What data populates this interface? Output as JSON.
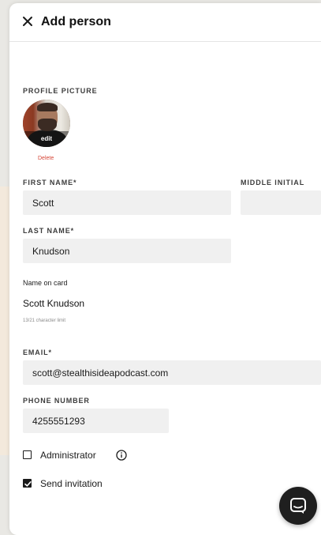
{
  "header": {
    "title": "Add person"
  },
  "profile": {
    "section_label": "PROFILE PICTURE",
    "edit_label": "edit",
    "delete_label": "Delete"
  },
  "form": {
    "first_name": {
      "label": "FIRST NAME",
      "required_mark": "*",
      "value": "Scott"
    },
    "middle_initial": {
      "label": "MIDDLE INITIAL",
      "value": ""
    },
    "last_name": {
      "label": "LAST NAME",
      "required_mark": "*",
      "value": "Knudson"
    },
    "name_on_card": {
      "label": "Name on card",
      "value": "Scott Knudson",
      "limit_text": "13/21 character limit"
    },
    "email": {
      "label": "EMAIL",
      "required_mark": "*",
      "value": "scott@stealthisideapodcast.com"
    },
    "phone": {
      "label": "PHONE NUMBER",
      "value": "4255551293"
    }
  },
  "options": {
    "administrator": {
      "label": "Administrator",
      "checked": false,
      "icon": "info-icon"
    },
    "send_invitation": {
      "label": "Send invitation",
      "checked": true
    }
  },
  "chat": {
    "icon": "chat-bubble-icon"
  },
  "colors": {
    "delete_red": "#d64536",
    "field_bg": "#f0f0f0",
    "text_dark": "#1a1a1a",
    "chat_bg": "#1f1f1f"
  }
}
